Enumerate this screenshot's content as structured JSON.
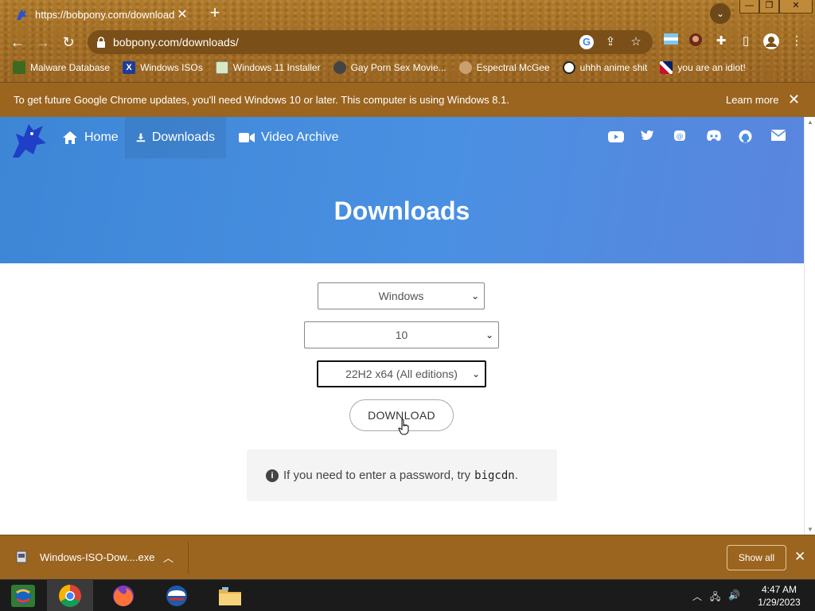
{
  "browser": {
    "tab_title": "https://bobpony.com/downloads/",
    "url": "bobpony.com/downloads/",
    "bookmarks": [
      {
        "label": "Malware Database",
        "icon": "malware-db-icon"
      },
      {
        "label": "Windows ISOs",
        "icon": "windows-isos-icon"
      },
      {
        "label": "Windows 11 Installer",
        "icon": "image-icon"
      },
      {
        "label": "Gay Porn Sex Movie...",
        "icon": "site-favicon"
      },
      {
        "label": "Espectral McGee",
        "icon": "avatar-favicon"
      },
      {
        "label": "uhhh anime shit",
        "icon": "anime-favicon"
      },
      {
        "label": "you are an idiot!",
        "icon": "uk-flag-icon"
      }
    ]
  },
  "infobar": {
    "message": "To get future Google Chrome updates, you'll need Windows 10 or later. This computer is using Windows 8.1.",
    "learn_more": "Learn more"
  },
  "site": {
    "nav": {
      "home": "Home",
      "downloads": "Downloads",
      "video_archive": "Video Archive"
    },
    "social_icons": [
      "youtube-icon",
      "twitter-icon",
      "mastodon-icon",
      "discord-icon",
      "github-icon",
      "mail-icon"
    ],
    "heading": "Downloads",
    "os_select": "Windows",
    "version_select": "10",
    "edition_select": "22H2 x64 (All editions)",
    "download_button": "DOWNLOAD",
    "note_text": "If you need to enter a password, try",
    "note_password": "bigcdn",
    "note_end": "."
  },
  "downloads_shelf": {
    "file_name": "Windows-ISO-Dow....exe",
    "show_all": "Show all"
  },
  "taskbar": {
    "apps": [
      "start-button",
      "chrome-icon",
      "firefox-icon",
      "ie-icon",
      "file-explorer-icon"
    ],
    "time": "4:47 AM",
    "date": "1/29/2023"
  },
  "colors": {
    "accent_blue": "#4a90e2",
    "frame_brown": "#9b6520"
  }
}
